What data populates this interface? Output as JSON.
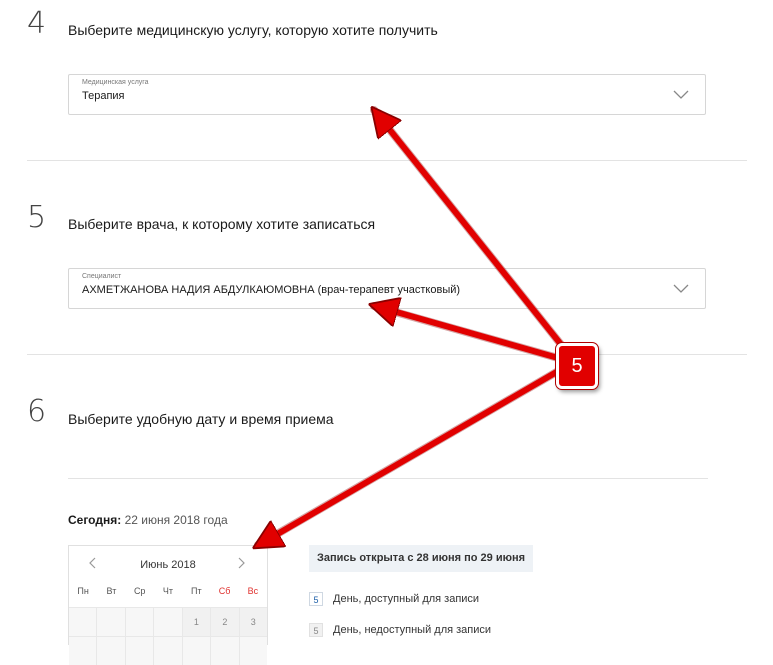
{
  "step4": {
    "number": "4",
    "title": "Выберите медицинскую услугу, которую хотите получить",
    "select": {
      "caption": "Медицинская услуга",
      "value": "Терапия"
    }
  },
  "step5": {
    "number": "5",
    "title": "Выберите врача, к которому хотите записаться",
    "select": {
      "caption": "Специалист",
      "value": "АХМЕТЖАНОВА НАДИЯ АБДУЛКАЮМОВНА (врач-терапевт участковый)"
    }
  },
  "step6": {
    "number": "6",
    "title": "Выберите удобную дату и время приема",
    "today": {
      "label": "Сегодня:",
      "value": "22 июня 2018 года"
    },
    "calendar": {
      "month": "Июнь 2018",
      "weekdays": [
        "Пн",
        "Вт",
        "Ср",
        "Чт",
        "Пт",
        "Сб",
        "Вс"
      ],
      "first_row": [
        "",
        "",
        "",
        "",
        "1",
        "2",
        "3"
      ]
    },
    "record_open": "Запись открыта с 28 июня по 29 июня",
    "legend": {
      "available": {
        "number": "5",
        "text": "День, доступный для записи"
      },
      "unavailable": {
        "number": "5",
        "text": "День, недоступный для записи"
      }
    }
  },
  "annotation": {
    "callout_number": "5",
    "color": "#e10000"
  },
  "icons": {
    "select_chevron": "chevron-down-icon",
    "calendar_prev": "chevron-left-icon",
    "calendar_next": "chevron-right-icon"
  }
}
